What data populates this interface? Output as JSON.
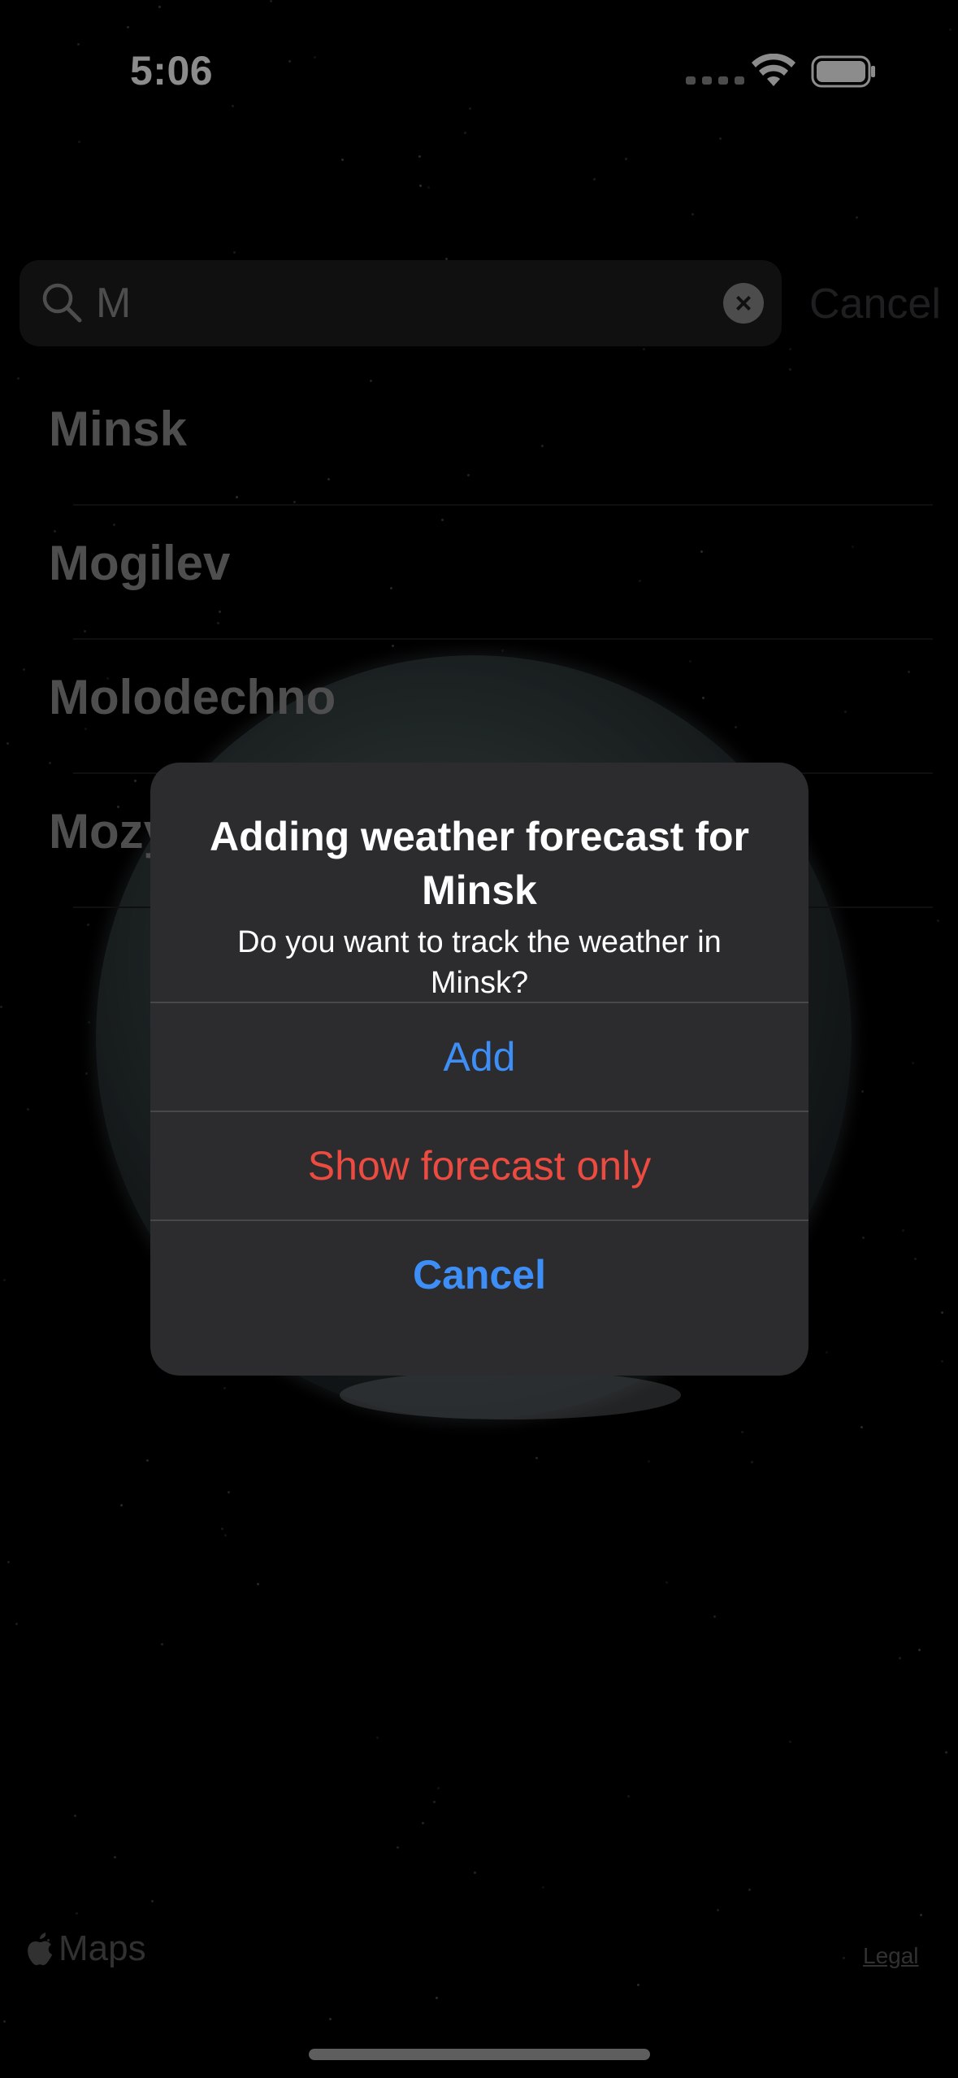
{
  "status_bar": {
    "time": "5:06"
  },
  "search": {
    "value": "M",
    "cancel_label": "Cancel"
  },
  "results": [
    {
      "label": "Minsk"
    },
    {
      "label": "Mogilev"
    },
    {
      "label": "Molodechno"
    },
    {
      "label": "Mozyr"
    }
  ],
  "alert": {
    "title": "Adding weather forecast for Minsk",
    "message": "Do you want to track the weather in Minsk?",
    "add_label": "Add",
    "show_forecast_label": "Show forecast only",
    "cancel_label": "Cancel"
  },
  "footer": {
    "maps_label": "Maps",
    "legal_label": "Legal"
  },
  "colors": {
    "accent_blue": "#3e8ef7",
    "destructive_red": "#eb4b41",
    "alert_bg": "#2c2c2e",
    "search_bg": "#1e1e20"
  }
}
